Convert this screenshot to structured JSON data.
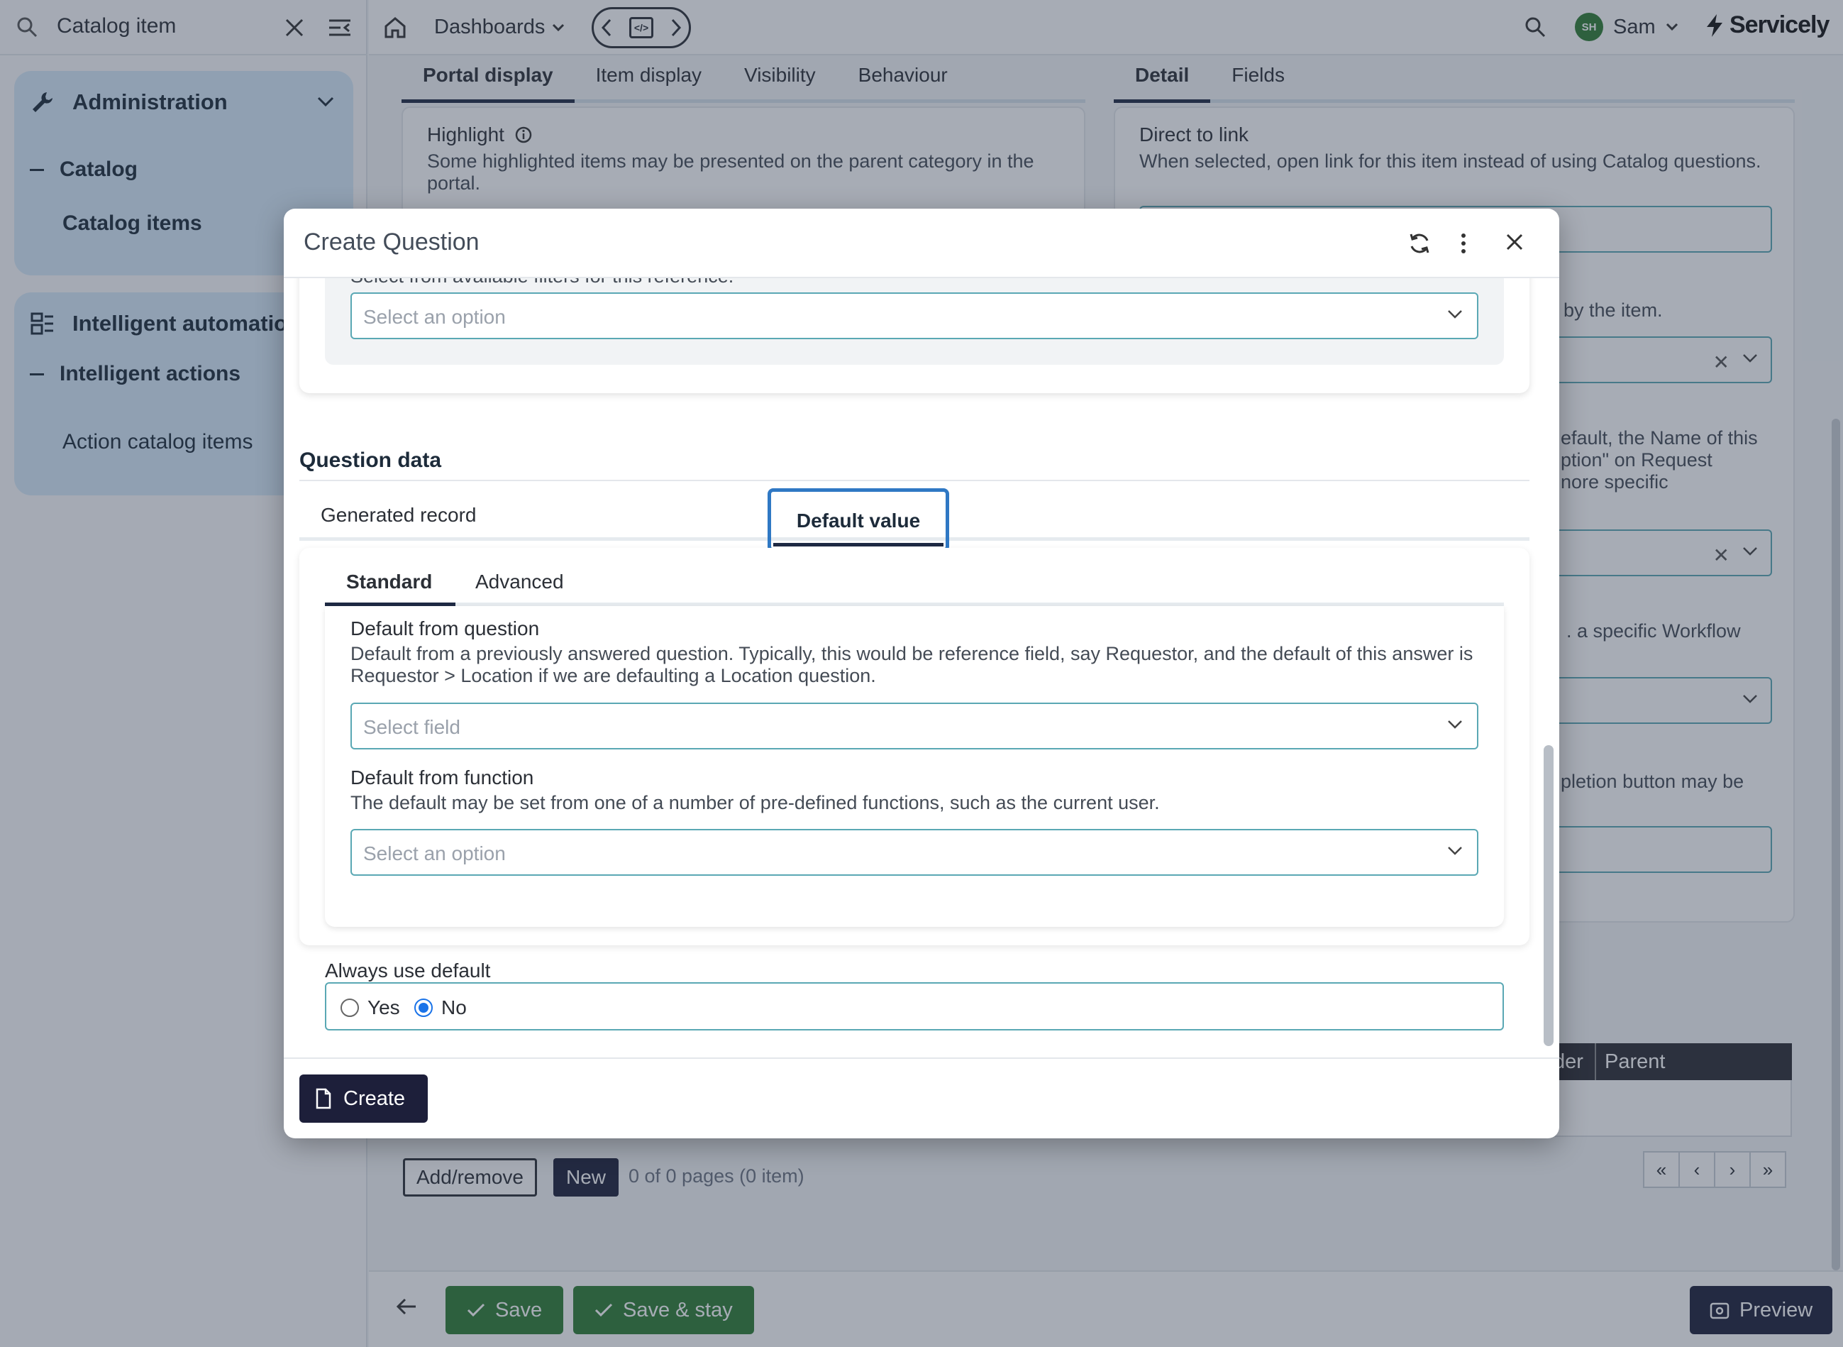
{
  "sidebar": {
    "search_value": "Catalog item",
    "groups": [
      {
        "label": "Administration",
        "sub": "Catalog",
        "item": "Catalog items"
      },
      {
        "label": "Intelligent automation",
        "sub": "Intelligent actions",
        "item": "Action catalog items"
      }
    ]
  },
  "topbar": {
    "dashboards": "Dashboards",
    "user_initials": "SH",
    "user_name": "Sam",
    "brand": "Servicely"
  },
  "background": {
    "left_tabs": [
      "Portal display",
      "Item display",
      "Visibility",
      "Behaviour"
    ],
    "right_tabs": [
      "Detail",
      "Fields"
    ],
    "highlight_label": "Highlight",
    "highlight_help": "Some highlighted items may be presented on the parent category in the portal.",
    "direct_link_label": "Direct to link",
    "direct_link_help": "When selected, open link for this item instead of using Catalog questions.",
    "frag1": "by the item.",
    "frag2a": "efault, the Name of this",
    "frag2b": "ption\" on Request",
    "frag2c": "nore specific",
    "frag3": ". a specific Workflow",
    "frag4": "pletion button may be",
    "table_cols": [
      "der",
      "Parent"
    ],
    "add_remove": "Add/remove",
    "new": "New",
    "pager_text": "0 of 0 pages (0 item)",
    "save": "Save",
    "save_stay": "Save & stay",
    "preview": "Preview"
  },
  "modal": {
    "title": "Create Question",
    "cut_help": "Select from available filters for this reference.",
    "filter_placeholder": "Select an option",
    "section_title": "Question data",
    "tabs": [
      "Generated record",
      "Default value"
    ],
    "sub_tabs": [
      "Standard",
      "Advanced"
    ],
    "default_question_label": "Default from question",
    "default_question_help": "Default from a previously answered question. Typically, this would be reference field, say Requestor, and the default of this answer is Requestor > Location if we are defaulting a Location question.",
    "default_question_placeholder": "Select field",
    "default_function_label": "Default from function",
    "default_function_help": "The default may be set from one of a number of pre-defined functions, such as the current user.",
    "default_function_placeholder": "Select an option",
    "always_label": "Always use default",
    "radio_yes": "Yes",
    "radio_no": "No",
    "create": "Create"
  }
}
